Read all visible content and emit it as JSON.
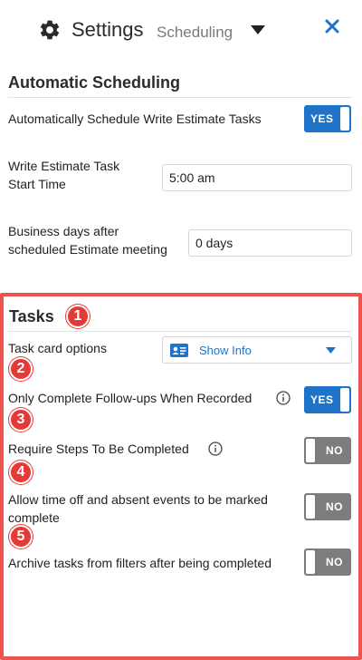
{
  "header": {
    "title": "Settings",
    "subtitle": "Scheduling",
    "icons": {
      "settings": "gear-icon",
      "menu": "caret-down-icon",
      "close": "close-icon"
    }
  },
  "automatic_scheduling": {
    "title": "Automatic Scheduling",
    "auto_schedule": {
      "label": "Automatically Schedule Write Estimate Tasks",
      "toggle": "YES",
      "enabled": true
    },
    "start_time": {
      "label_line1": "Write Estimate Task",
      "label_line2": "Start Time",
      "value": "5:00 am"
    },
    "business_days": {
      "label_line1": "Business days after",
      "label_line2": "scheduled Estimate meeting",
      "value": "0 days"
    }
  },
  "tasks": {
    "title": "Tasks",
    "card_options": {
      "label": "Task card options",
      "selected": "Show Info",
      "icon": "id-card-icon"
    },
    "follow_ups": {
      "label": "Only Complete Follow-ups When Recorded",
      "toggle": "YES",
      "enabled": true
    },
    "require_steps": {
      "label": "Require Steps To Be Completed",
      "toggle": "NO",
      "enabled": false
    },
    "time_off": {
      "label_line1": "Allow time off and absent events to be marked",
      "label_line2": "complete",
      "toggle": "NO",
      "enabled": false
    },
    "archive": {
      "label": "Archive tasks from filters after being completed",
      "toggle": "NO",
      "enabled": false
    }
  },
  "annotations": [
    "1",
    "2",
    "3",
    "4",
    "5"
  ],
  "colors": {
    "accent": "#1f73c9",
    "toggle_off": "#7d7d7d",
    "highlight": "#ef5350",
    "badge": "#e53935"
  }
}
